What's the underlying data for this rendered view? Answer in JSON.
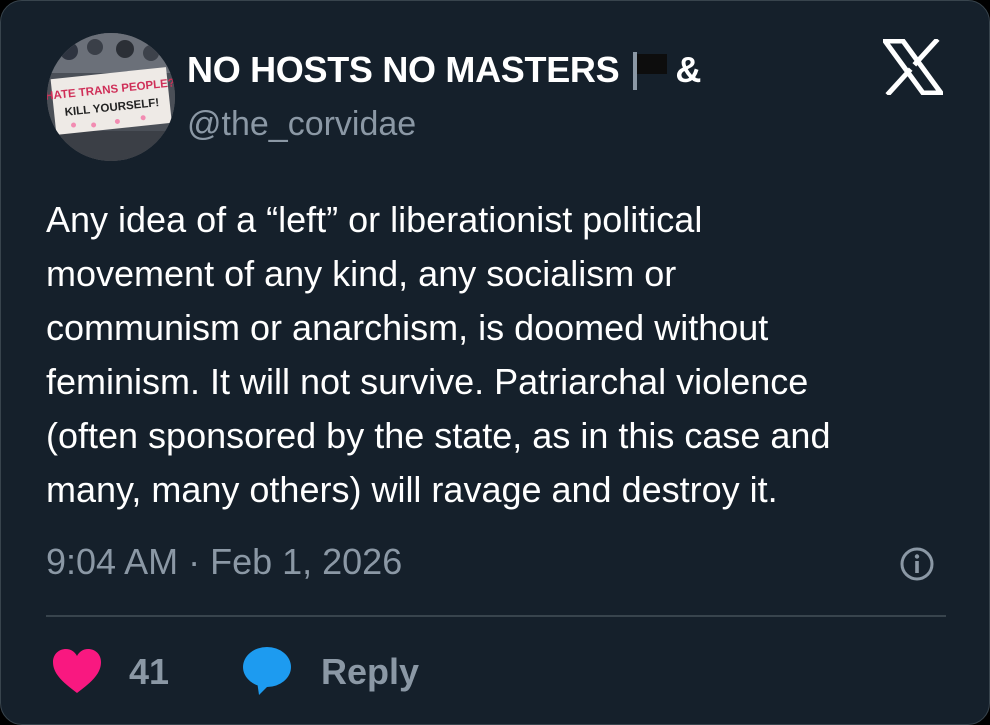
{
  "tweet": {
    "author": {
      "display_name": "NO HOSTS NO MASTERS",
      "display_name_suffix": "&",
      "handle": "@the_corvidae",
      "avatar_sign_lines": [
        "HATE TRANS PEOPLE?",
        "KILL YOURSELF!"
      ]
    },
    "text": "Any idea of a “left” or liberationist political\nmovement of any kind, any socialism or\ncommunism or anarchism, is doomed without\nfeminism. It will not survive. Patriarchal violence\n(often sponsored by the state, as in this case and\nmany, many others) will ravage and destroy it.",
    "timestamp": "9:04 AM · Feb 1, 2026",
    "likes": "41",
    "reply_label": "Reply",
    "icons": {
      "brand": "x-logo-icon",
      "flag": "black-flag-icon",
      "info": "info-icon",
      "like": "heart-icon",
      "reply": "speech-bubble-icon"
    }
  },
  "colors": {
    "background": "#15202b",
    "text": "#ffffff",
    "secondary": "#8b98a5",
    "divider": "#38444d",
    "like": "#f91880",
    "reply": "#1d9bf0"
  }
}
